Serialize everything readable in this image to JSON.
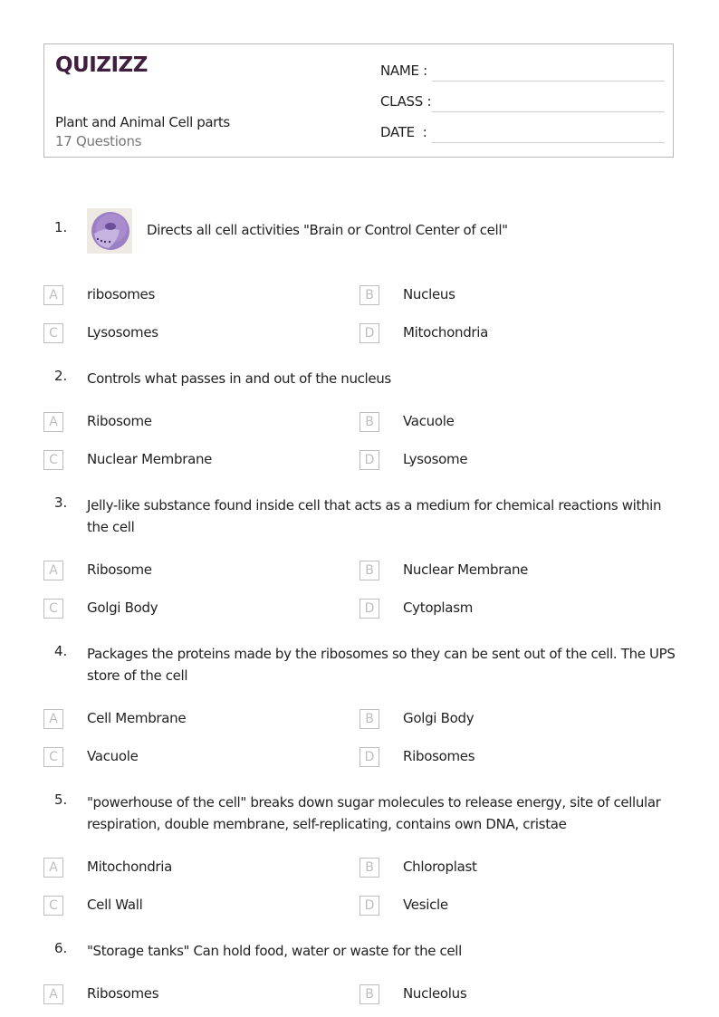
{
  "header": {
    "logo_text": "QUIZIZZ",
    "brand_color": "#3f1f3d",
    "title": "Plant and Animal Cell parts",
    "question_count": "17 Questions",
    "fields": [
      {
        "label": "NAME :",
        "value": ""
      },
      {
        "label": "CLASS :",
        "value": ""
      },
      {
        "label": "DATE  :",
        "value": ""
      }
    ]
  },
  "questions": [
    {
      "number": "1.",
      "text": "Directs all cell activities \"Brain or Control Center of cell\"",
      "image": "cell-nucleus-illustration",
      "options": [
        {
          "letter": "A",
          "text": "ribosomes"
        },
        {
          "letter": "B",
          "text": "Nucleus"
        },
        {
          "letter": "C",
          "text": "Lysosomes"
        },
        {
          "letter": "D",
          "text": "Mitochondria"
        }
      ]
    },
    {
      "number": "2.",
      "text": "Controls what passes in and out of the nucleus",
      "options": [
        {
          "letter": "A",
          "text": "Ribosome"
        },
        {
          "letter": "B",
          "text": "Vacuole"
        },
        {
          "letter": "C",
          "text": "Nuclear Membrane"
        },
        {
          "letter": "D",
          "text": "Lysosome"
        }
      ]
    },
    {
      "number": "3.",
      "text": "Jelly-like substance found inside cell that acts as a medium for chemical reactions within the cell",
      "options": [
        {
          "letter": "A",
          "text": "Ribosome"
        },
        {
          "letter": "B",
          "text": "Nuclear Membrane"
        },
        {
          "letter": "C",
          "text": "Golgi Body"
        },
        {
          "letter": "D",
          "text": "Cytoplasm"
        }
      ]
    },
    {
      "number": "4.",
      "text": "Packages the proteins made by the ribosomes so they can be sent out of the cell. The UPS store of the cell",
      "options": [
        {
          "letter": "A",
          "text": "Cell Membrane"
        },
        {
          "letter": "B",
          "text": "Golgi Body"
        },
        {
          "letter": "C",
          "text": "Vacuole"
        },
        {
          "letter": "D",
          "text": "Ribosomes"
        }
      ]
    },
    {
      "number": "5.",
      "text": "\"powerhouse of the cell\" breaks down sugar molecules to release energy, site of cellular respiration, double membrane, self-replicating, contains own DNA, cristae",
      "options": [
        {
          "letter": "A",
          "text": "Mitochondria"
        },
        {
          "letter": "B",
          "text": "Chloroplast"
        },
        {
          "letter": "C",
          "text": "Cell Wall"
        },
        {
          "letter": "D",
          "text": "Vesicle"
        }
      ]
    },
    {
      "number": "6.",
      "text": "\"Storage tanks\" Can hold food, water or waste for the cell",
      "options": [
        {
          "letter": "A",
          "text": "Ribosomes"
        },
        {
          "letter": "B",
          "text": "Nucleolus"
        }
      ]
    }
  ]
}
